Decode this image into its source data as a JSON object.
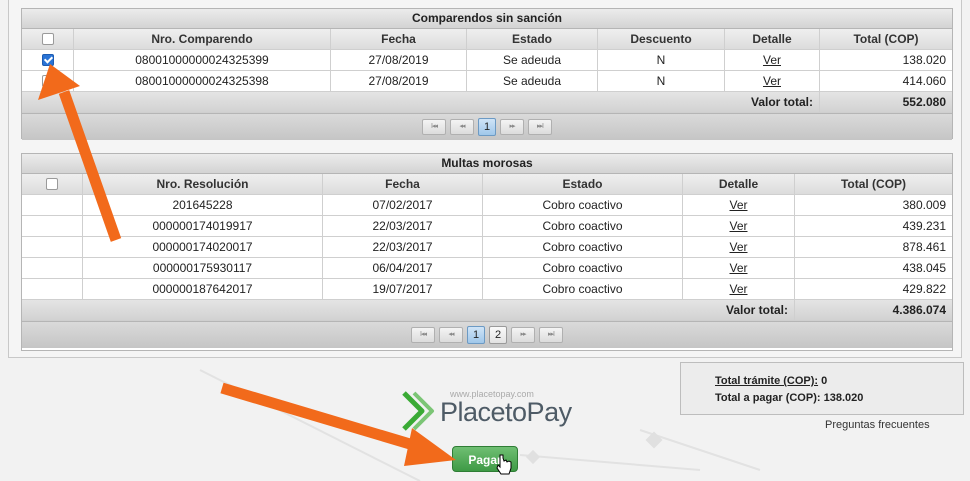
{
  "comparendos": {
    "title": "Comparendos sin sanción",
    "columns": [
      "Nro. Comparendo",
      "Fecha",
      "Estado",
      "Descuento",
      "Detalle",
      "Total (COP)"
    ],
    "rows": [
      {
        "checked": true,
        "numero": "08001000000024325399",
        "fecha": "27/08/2019",
        "estado": "Se adeuda",
        "descuento": "N",
        "detalle": "Ver",
        "total": "138.020"
      },
      {
        "checked": false,
        "numero": "08001000000024325398",
        "fecha": "27/08/2019",
        "estado": "Se adeuda",
        "descuento": "N",
        "detalle": "Ver",
        "total": "414.060"
      }
    ],
    "footer_label": "Valor total:",
    "footer_value": "552.080",
    "pager": {
      "first": "I◂◂",
      "prev": "◂◂",
      "pages": [
        "1"
      ],
      "active": "1",
      "next": "▸▸",
      "last": "▸▸I"
    }
  },
  "multas": {
    "title": "Multas morosas",
    "columns": [
      "Nro. Resolución",
      "Fecha",
      "Estado",
      "Detalle",
      "Total (COP)"
    ],
    "rows": [
      {
        "numero": "201645228",
        "fecha": "07/02/2017",
        "estado": "Cobro coactivo",
        "detalle": "Ver",
        "total": "380.009"
      },
      {
        "numero": "000000174019917",
        "fecha": "22/03/2017",
        "estado": "Cobro coactivo",
        "detalle": "Ver",
        "total": "439.231"
      },
      {
        "numero": "000000174020017",
        "fecha": "22/03/2017",
        "estado": "Cobro coactivo",
        "detalle": "Ver",
        "total": "878.461"
      },
      {
        "numero": "000000175930117",
        "fecha": "06/04/2017",
        "estado": "Cobro coactivo",
        "detalle": "Ver",
        "total": "438.045"
      },
      {
        "numero": "000000187642017",
        "fecha": "19/07/2017",
        "estado": "Cobro coactivo",
        "detalle": "Ver",
        "total": "429.822"
      }
    ],
    "footer_label": "Valor total:",
    "footer_value": "4.386.074",
    "pager": {
      "first": "I◂◂",
      "prev": "◂◂",
      "pages": [
        "1",
        "2"
      ],
      "active": "1",
      "next": "▸▸",
      "last": "▸▸I"
    }
  },
  "summary": {
    "tramite_label": "Total trámite (COP):",
    "tramite_value": "0",
    "pagar_label": "Total a pagar (COP):",
    "pagar_value": "138.020"
  },
  "faq_link": "Preguntas frecuentes",
  "placetopay": {
    "url": "www.placetopay.com",
    "name": "PlacetoPay"
  },
  "pay_button": "Pagar",
  "colors": {
    "arrow": "#f26a1b",
    "logo_green": "#3aaa35",
    "button_green": "#4ea553",
    "checkbox_blue": "#2a74d6"
  }
}
